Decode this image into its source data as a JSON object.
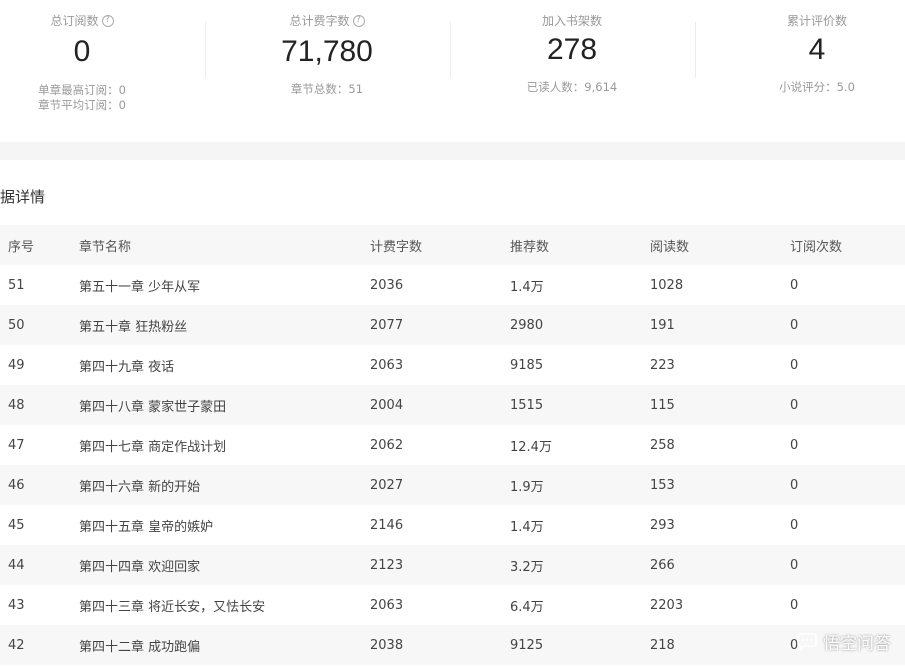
{
  "stats": [
    {
      "label": "总订阅数",
      "value": "0",
      "subs": [
        "单章最高订阅：0",
        "章节平均订阅：0"
      ],
      "help": true
    },
    {
      "label": "总计费字数",
      "value": "71,780",
      "subs": [
        "章节总数：51"
      ],
      "help": true
    },
    {
      "label": "加入书架数",
      "value": "278",
      "subs": [
        "已读人数：9,614"
      ],
      "help": false
    },
    {
      "label": "累计评价数",
      "value": "4",
      "subs": [
        "小说评分：5.0"
      ],
      "help": false
    }
  ],
  "section_title": "据详情",
  "table": {
    "headers": [
      "序号",
      "章节名称",
      "计费字数",
      "推荐数",
      "阅读数",
      "订阅次数"
    ],
    "rows": [
      [
        "51",
        "第五十一章 少年从军",
        "2036",
        "1.4万",
        "1028",
        "0"
      ],
      [
        "50",
        "第五十章 狂热粉丝",
        "2077",
        "2980",
        "191",
        "0"
      ],
      [
        "49",
        "第四十九章 夜话",
        "2063",
        "9185",
        "223",
        "0"
      ],
      [
        "48",
        "第四十八章 蒙家世子蒙田",
        "2004",
        "1515",
        "115",
        "0"
      ],
      [
        "47",
        "第四十七章 商定作战计划",
        "2062",
        "12.4万",
        "258",
        "0"
      ],
      [
        "46",
        "第四十六章 新的开始",
        "2027",
        "1.9万",
        "153",
        "0"
      ],
      [
        "45",
        "第四十五章 皇帝的嫉妒",
        "2146",
        "1.4万",
        "293",
        "0"
      ],
      [
        "44",
        "第四十四章 欢迎回家",
        "2123",
        "3.2万",
        "266",
        "0"
      ],
      [
        "43",
        "第四十三章 将近长安，又怯长安",
        "2063",
        "6.4万",
        "2203",
        "0"
      ],
      [
        "42",
        "第四十二章 成功跑偏",
        "2038",
        "9125",
        "218",
        "0"
      ]
    ]
  },
  "watermark": {
    "text": "悟空问答",
    "icon": "chat-bubble-icon"
  }
}
